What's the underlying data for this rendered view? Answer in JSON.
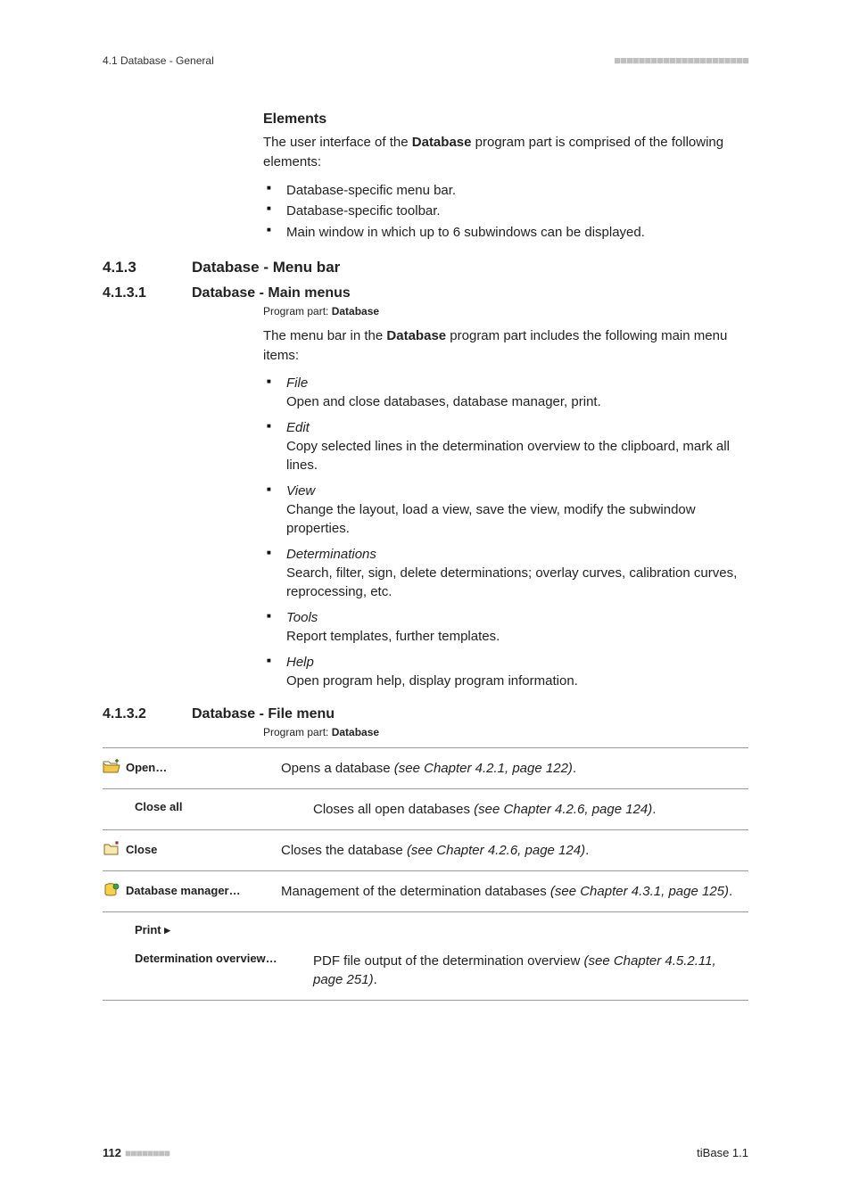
{
  "header": {
    "left": "4.1 Database - General"
  },
  "elements": {
    "heading": "Elements",
    "intro_pre": "The user interface of the ",
    "intro_strong": "Database",
    "intro_post": " program part is comprised of the following elements:",
    "bullets": [
      "Database-specific menu bar.",
      "Database-specific toolbar.",
      "Main window in which up to 6 subwindows can be displayed."
    ]
  },
  "sec413": {
    "num": "4.1.3",
    "title": "Database - Menu bar"
  },
  "sec4131": {
    "num": "4.1.3.1",
    "title": "Database - Main menus",
    "pp_label": "Program part: ",
    "pp_value": "Database",
    "intro_pre": "The menu bar in the ",
    "intro_strong": "Database",
    "intro_post": " program part includes the following main menu items:",
    "items": [
      {
        "name": "File",
        "desc": "Open and close databases, database manager, print."
      },
      {
        "name": "Edit",
        "desc": "Copy selected lines in the determination overview to the clipboard, mark all lines."
      },
      {
        "name": "View",
        "desc": "Change the layout, load a view, save the view, modify the subwindow properties."
      },
      {
        "name": "Determinations",
        "desc": "Search, filter, sign, delete determinations; overlay curves, calibration curves, reprocessing, etc."
      },
      {
        "name": "Tools",
        "desc": "Report templates, further templates."
      },
      {
        "name": "Help",
        "desc": "Open program help, display program information."
      }
    ]
  },
  "sec4132": {
    "num": "4.1.3.2",
    "title": "Database - File menu",
    "pp_label": "Program part: ",
    "pp_value": "Database",
    "rows": [
      {
        "icon": "open",
        "label": "Open…",
        "desc": "Opens a database ",
        "ref": "(see Chapter 4.2.1, page 122)",
        "tail": "."
      },
      {
        "icon": "",
        "label": "Close all",
        "desc": "Closes all open databases ",
        "ref": "(see Chapter 4.2.6, page 124)",
        "tail": "."
      },
      {
        "icon": "close",
        "label": "Close",
        "desc": "Closes the database ",
        "ref": "(see Chapter 4.2.6, page 124)",
        "tail": "."
      },
      {
        "icon": "mgr",
        "label": "Database manager…",
        "desc": "Management of the determination databases ",
        "ref": "(see Chapter 4.3.1, page 125)",
        "tail": "."
      },
      {
        "icon": "",
        "label": "Print ▸",
        "desc": "",
        "ref": "",
        "tail": ""
      },
      {
        "icon": "",
        "label": "Determination overview…",
        "sub": true,
        "desc": "PDF file output of the determination overview ",
        "ref": "(see Chapter 4.5.2.11, page 251)",
        "tail": "."
      }
    ]
  },
  "footer": {
    "page": "112",
    "right": "tiBase 1.1"
  }
}
